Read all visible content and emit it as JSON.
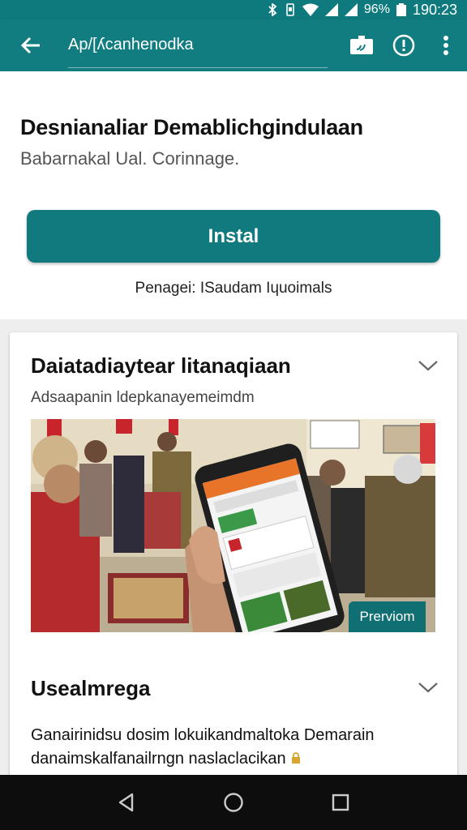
{
  "status_bar": {
    "battery": "96%",
    "time": "190:23"
  },
  "app_bar": {
    "title": "Ap/[ʎcanhenodka"
  },
  "header": {
    "title": "Desnianaliar Demablichgindulaan",
    "subtitle": "Babarnakal Ual. Corinnage.",
    "install_label": "Instal",
    "manager": "Penagei: ISaudam Iɥuoimals"
  },
  "details": {
    "title": "Daiatadiaytear litanaqiaan",
    "subtitle": "Adsaapanin ldepkanayemeimdm",
    "preview_label": "Prerviom"
  },
  "section2": {
    "title": "Usealmrega",
    "body_line1": "Ganairinidsu dosim lokuikandmaltoka Demarain",
    "body_line2": "danaimskalfanailrngn naslaclacikan"
  },
  "colors": {
    "primary": "#117d80",
    "install": "#107a7e",
    "phone_header": "#e8742a"
  },
  "icons": [
    "back-arrow-icon",
    "cast-icon",
    "info-icon",
    "more-vert-icon",
    "chevron-down-icon",
    "nav-back-icon",
    "nav-home-icon",
    "nav-recents-icon",
    "bluetooth-icon",
    "wifi-icon",
    "signal-icon",
    "battery-icon"
  ]
}
